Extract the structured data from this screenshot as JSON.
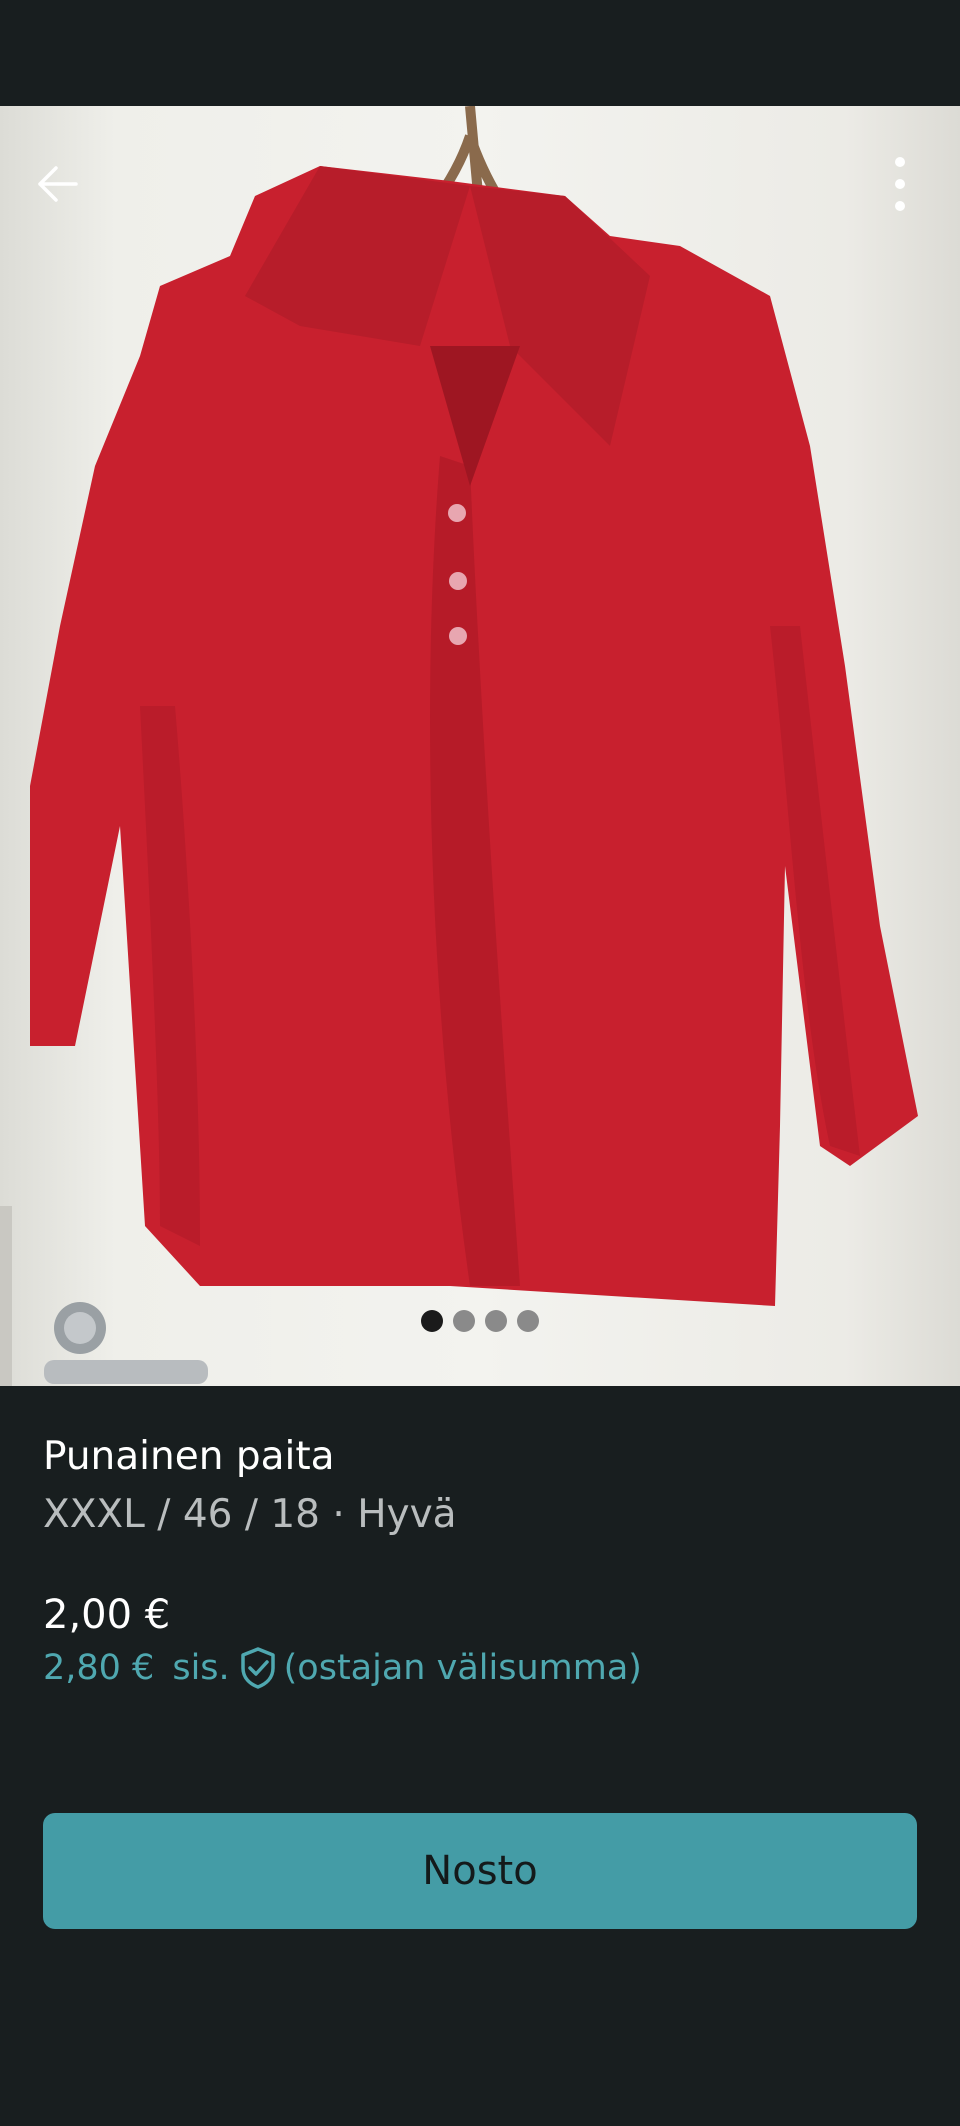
{
  "colors": {
    "background": "#181e1f",
    "accent": "#449ca6",
    "accent_text": "#4fa8b0",
    "shirt": "#c8202e"
  },
  "photo": {
    "description_icon": "red-shirt-photo",
    "carousel_count": 4,
    "carousel_active_index": 0
  },
  "toolbar": {
    "back_icon": "arrow-left-icon",
    "more_icon": "more-vertical-icon"
  },
  "item": {
    "title": "Punainen paita",
    "details": "XXXL / 46 / 18 · Hyvä",
    "price": "2,00 €",
    "buyer_price": "2,80 €",
    "buyer_price_incl": "sis.",
    "buyer_price_note": "(ostajan välisumma)",
    "protection_icon": "shield-check-icon"
  },
  "actions": {
    "buy_label": "Nosto"
  }
}
